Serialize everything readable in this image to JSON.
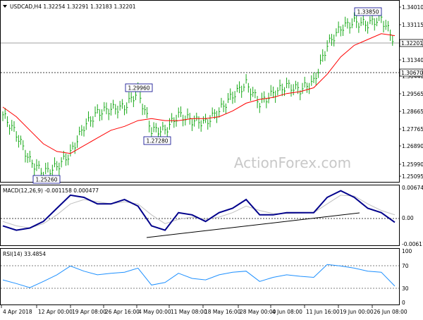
{
  "colors": {
    "price": "#00a000",
    "ma": "#ff0000",
    "macd": "#00008b",
    "signal": "#c0c0c0",
    "rsi": "#1e90ff",
    "frame": "#000000",
    "watermark": "#c8c8c8",
    "label_border": "#00008b"
  },
  "symbol_header": "USDCAD,H4  1.32254 1.32291 1.32183 1.32201",
  "macd_header": "MACD(12,26,9) -0.001158 0.000477",
  "rsi_header": "RSI(14) 33.4854",
  "watermark": "ActionForex.com",
  "price_axis_labels": [
    "1.34010",
    "1.33115",
    "1.31340",
    "1.30440",
    "1.29565",
    "1.28665",
    "1.27765",
    "1.26890",
    "1.25990",
    "1.25095"
  ],
  "current_price_label": "1.32201",
  "level_label": "1.30670",
  "macd_axis_labels": [
    "0.006745",
    "0.00",
    "-0.006115"
  ],
  "rsi_axis_labels": [
    "100",
    "70",
    "30",
    "0"
  ],
  "time_axis_labels": [
    "4 Apr 2018",
    "12 Apr 00:00",
    "19 Apr 08:00",
    "26 Apr 16:00",
    "4 May 00:00",
    "11 May 08:00",
    "18 May 16:00",
    "28 May 00:00",
    "4 Jun 08:00",
    "11 Jun 16:00",
    "19 Jun 00:00",
    "26 Jun 08:00"
  ],
  "annotations": {
    "a1": "1.33850",
    "a2": "1.29960",
    "a3": "1.27280",
    "a4": "1.25260"
  },
  "chart_data": [
    {
      "type": "line",
      "panel": "price",
      "ylim": [
        1.25,
        1.342
      ],
      "x": [
        "2018-04-04",
        "2018-04-07",
        "2018-04-10",
        "2018-04-13",
        "2018-04-16",
        "2018-04-19",
        "2018-04-22",
        "2018-04-25",
        "2018-04-28",
        "2018-05-01",
        "2018-05-04",
        "2018-05-07",
        "2018-05-10",
        "2018-05-13",
        "2018-05-16",
        "2018-05-19",
        "2018-05-22",
        "2018-05-25",
        "2018-05-28",
        "2018-05-31",
        "2018-06-03",
        "2018-06-06",
        "2018-06-09",
        "2018-06-12",
        "2018-06-15",
        "2018-06-18",
        "2018-06-21",
        "2018-06-24",
        "2018-06-27",
        "2018-06-29"
      ],
      "series": [
        {
          "values": [
            1.284,
            1.274,
            1.26,
            1.254,
            1.257,
            1.264,
            1.278,
            1.285,
            1.287,
            1.288,
            1.296,
            1.276,
            1.276,
            1.284,
            1.281,
            1.28,
            1.286,
            1.294,
            1.3,
            1.29,
            1.295,
            1.299,
            1.297,
            1.301,
            1.32,
            1.329,
            1.332,
            1.331,
            1.334,
            1.322
          ]
        },
        {
          "values": [
            1.288,
            1.283,
            1.276,
            1.269,
            1.265,
            1.264,
            1.268,
            1.272,
            1.276,
            1.278,
            1.281,
            1.282,
            1.281,
            1.281,
            1.282,
            1.282,
            1.283,
            1.286,
            1.29,
            1.292,
            1.293,
            1.295,
            1.296,
            1.298,
            1.305,
            1.314,
            1.32,
            1.323,
            1.326,
            1.325
          ]
        }
      ],
      "horizontal_lines": [
        1.32201,
        1.3067
      ]
    },
    {
      "type": "line",
      "panel": "macd",
      "ylim": [
        -0.006115,
        0.006745
      ],
      "series": [
        {
          "values": [
            -0.002,
            -0.003,
            -0.0025,
            -0.001,
            0.002,
            0.005,
            0.0045,
            0.003,
            0.003,
            0.004,
            0.0025,
            -0.002,
            -0.003,
            0.001,
            0.0005,
            -0.001,
            0.001,
            0.002,
            0.004,
            0.0005,
            0.0005,
            0.001,
            0.001,
            0.001,
            0.0045,
            0.006,
            0.0045,
            0.002,
            0.001,
            -0.0012
          ]
        },
        {
          "values": [
            -0.001,
            -0.002,
            -0.0025,
            -0.0015,
            0.0005,
            0.003,
            0.004,
            0.0035,
            0.003,
            0.0035,
            0.003,
            0.0005,
            -0.0015,
            -0.0005,
            0.0,
            -0.0005,
            0.0,
            0.001,
            0.0025,
            0.0015,
            0.0008,
            0.0008,
            0.0009,
            0.001,
            0.003,
            0.005,
            0.0048,
            0.003,
            0.0015,
            0.0005
          ]
        }
      ]
    },
    {
      "type": "line",
      "panel": "rsi",
      "ylim": [
        0,
        100
      ],
      "series": [
        {
          "values": [
            45,
            38,
            30,
            42,
            55,
            72,
            62,
            55,
            58,
            60,
            68,
            35,
            40,
            58,
            48,
            45,
            55,
            60,
            62,
            42,
            50,
            55,
            52,
            50,
            75,
            72,
            68,
            62,
            60,
            33
          ]
        }
      ]
    }
  ]
}
